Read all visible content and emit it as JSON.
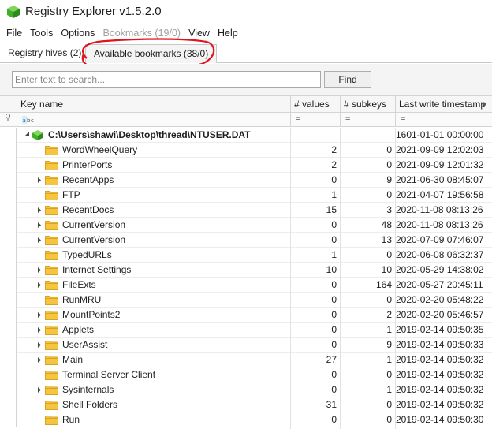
{
  "window": {
    "title": "Registry Explorer v1.5.2.0"
  },
  "menu": [
    "File",
    "Tools",
    "Options",
    "Bookmarks (19/0)",
    "View",
    "Help"
  ],
  "tabs": {
    "registry_hives": "Registry hives (2)",
    "available_bookmarks": "Available bookmarks (38/0)"
  },
  "search": {
    "placeholder": "Enter text to search...",
    "value": "",
    "find_label": "Find"
  },
  "columns": {
    "key_name": "Key name",
    "values": "# values",
    "subkeys": "# subkeys",
    "timestamp": "Last write timestamp"
  },
  "filter": {
    "key_name_icon": "abc-filter-icon",
    "equals": "="
  },
  "root": {
    "name": "C:\\Users\\shawi\\Desktop\\thread\\NTUSER.DAT",
    "timestamp": "1601-01-01 00:00:00"
  },
  "rows": [
    {
      "name": "WordWheelQuery",
      "values": "2",
      "subkeys": "0",
      "timestamp": "2021-09-09 12:02:03",
      "expandable": false
    },
    {
      "name": "PrinterPorts",
      "values": "2",
      "subkeys": "0",
      "timestamp": "2021-09-09 12:01:32",
      "expandable": false
    },
    {
      "name": "RecentApps",
      "values": "0",
      "subkeys": "9",
      "timestamp": "2021-06-30 08:45:07",
      "expandable": true
    },
    {
      "name": "FTP",
      "values": "1",
      "subkeys": "0",
      "timestamp": "2021-04-07 19:56:58",
      "expandable": false
    },
    {
      "name": "RecentDocs",
      "values": "15",
      "subkeys": "3",
      "timestamp": "2020-11-08 08:13:26",
      "expandable": true
    },
    {
      "name": "CurrentVersion",
      "values": "0",
      "subkeys": "48",
      "timestamp": "2020-11-08 08:13:26",
      "expandable": true
    },
    {
      "name": "CurrentVersion",
      "values": "0",
      "subkeys": "13",
      "timestamp": "2020-07-09 07:46:07",
      "expandable": true
    },
    {
      "name": "TypedURLs",
      "values": "1",
      "subkeys": "0",
      "timestamp": "2020-06-08 06:32:37",
      "expandable": false
    },
    {
      "name": "Internet Settings",
      "values": "10",
      "subkeys": "10",
      "timestamp": "2020-05-29 14:38:02",
      "expandable": true
    },
    {
      "name": "FileExts",
      "values": "0",
      "subkeys": "164",
      "timestamp": "2020-05-27 20:45:11",
      "expandable": true
    },
    {
      "name": "RunMRU",
      "values": "0",
      "subkeys": "0",
      "timestamp": "2020-02-20 05:48:22",
      "expandable": false
    },
    {
      "name": "MountPoints2",
      "values": "0",
      "subkeys": "2",
      "timestamp": "2020-02-20 05:46:57",
      "expandable": true
    },
    {
      "name": "Applets",
      "values": "0",
      "subkeys": "1",
      "timestamp": "2019-02-14 09:50:35",
      "expandable": true
    },
    {
      "name": "UserAssist",
      "values": "0",
      "subkeys": "9",
      "timestamp": "2019-02-14 09:50:33",
      "expandable": true
    },
    {
      "name": "Main",
      "values": "27",
      "subkeys": "1",
      "timestamp": "2019-02-14 09:50:32",
      "expandable": true
    },
    {
      "name": "Terminal Server Client",
      "values": "0",
      "subkeys": "0",
      "timestamp": "2019-02-14 09:50:32",
      "expandable": false
    },
    {
      "name": "Sysinternals",
      "values": "0",
      "subkeys": "1",
      "timestamp": "2019-02-14 09:50:32",
      "expandable": true
    },
    {
      "name": "Shell Folders",
      "values": "31",
      "subkeys": "0",
      "timestamp": "2019-02-14 09:50:32",
      "expandable": false
    },
    {
      "name": "Run",
      "values": "0",
      "subkeys": "0",
      "timestamp": "2019-02-14 09:50:30",
      "expandable": false
    }
  ],
  "colors": {
    "folder": "#f5c542",
    "folder_dark": "#d9a520",
    "annotation": "#e0141e",
    "app_icon": "#3fae29"
  }
}
